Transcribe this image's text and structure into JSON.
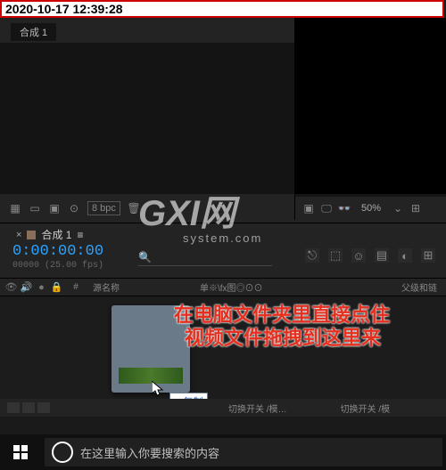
{
  "timestamp": "2020-10-17 12:39:28",
  "watermark": {
    "big": "GXI网",
    "small": "system.com"
  },
  "project": {
    "tab": "合成 1",
    "bpc": "8 bpc"
  },
  "viewer": {
    "zoom": "50%"
  },
  "timeline": {
    "tab": "合成 1",
    "tab_suffix": "≡",
    "timecode": "0:00:00:00",
    "fps_label": "00000 (25.00 fps)",
    "col_num": "#",
    "col_name": "源名称",
    "col_switches": "单※\\fx图◎⊙⊙",
    "col_parent": "父级和链",
    "footer_toggle1": "切换开关 /模…",
    "footer_toggle2": "切换开关 /模"
  },
  "hint": {
    "line1": "在电脑文件夹里直接点住",
    "line2": "视频文件拖拽到这里来",
    "copy_label": "+ 复制"
  },
  "taskbar": {
    "search_placeholder": "在这里输入你要搜索的内容"
  }
}
